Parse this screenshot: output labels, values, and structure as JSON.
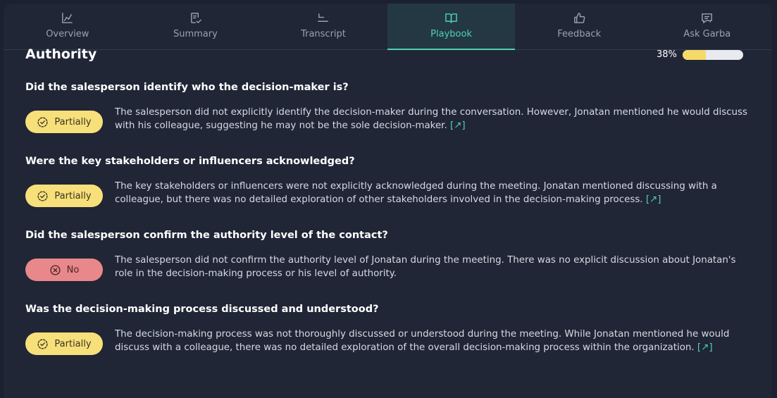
{
  "tabs": [
    {
      "label": "Overview",
      "icon": "chart-icon"
    },
    {
      "label": "Summary",
      "icon": "document-check-icon"
    },
    {
      "label": "Transcript",
      "icon": "lines-icon"
    },
    {
      "label": "Playbook",
      "icon": "book-icon",
      "active": true
    },
    {
      "label": "Feedback",
      "icon": "thumbs-up-icon"
    },
    {
      "label": "Ask Garba",
      "icon": "chat-question-icon"
    }
  ],
  "section": {
    "title": "Authority",
    "progress_label": "38%",
    "progress_value": 0.38
  },
  "questions": [
    {
      "title": "Did the salesperson identify who the decision-maker is?",
      "badge": "Partially",
      "answer": "The salesperson did not explicitly identify the decision-maker during the conversation. However, Jonatan mentioned he would discuss with his colleague, suggesting he may not be the sole decision-maker.",
      "link": "[↗]"
    },
    {
      "title": "Were the key stakeholders or influencers acknowledged?",
      "badge": "Partially",
      "answer": "The key stakeholders or influencers were not explicitly acknowledged during the meeting. Jonatan mentioned discussing with a colleague, but there was no detailed exploration of other stakeholders involved in the decision-making process.",
      "link": "[↗]"
    },
    {
      "title": "Did the salesperson confirm the authority level of the contact?",
      "badge": "No",
      "answer": "The salesperson did not confirm the authority level of Jonatan during the meeting. There was no explicit discussion about Jonatan's role in the decision-making process or his level of authority.",
      "link": ""
    },
    {
      "title": "Was the decision-making process discussed and understood?",
      "badge": "Partially",
      "answer": "The decision-making process was not thoroughly discussed or understood during the meeting. While Jonatan mentioned he would discuss with a colleague, there was no detailed exploration of the overall decision-making process within the organization.",
      "link": "[↗]"
    }
  ],
  "colors": {
    "accent": "#4fd1b0",
    "partial_badge": "#f7df7a",
    "no_badge": "#e8888a",
    "background": "#202636"
  }
}
